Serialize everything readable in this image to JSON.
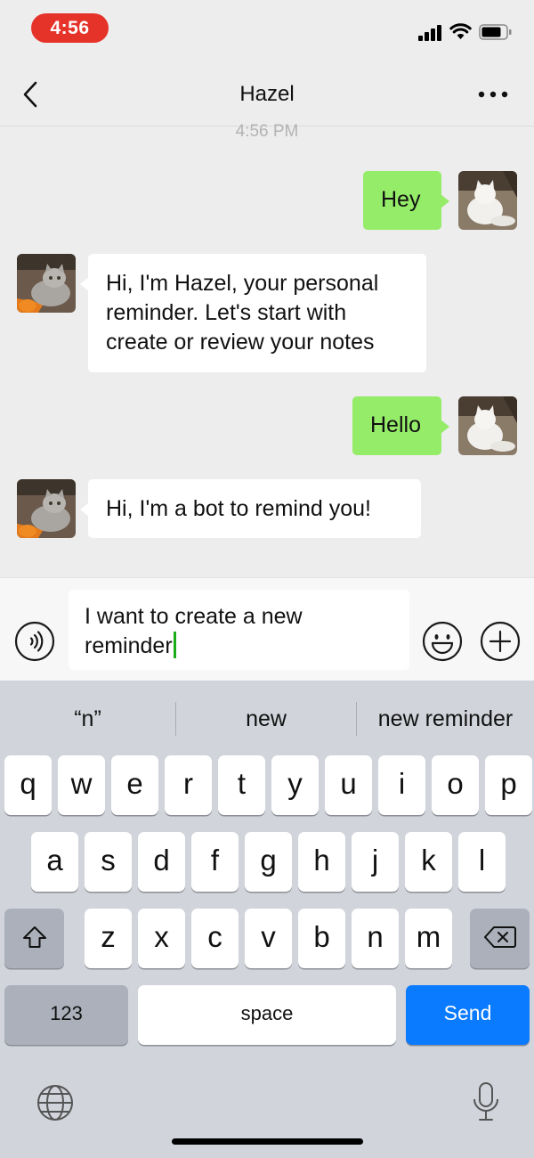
{
  "status_bar": {
    "time": "4:56"
  },
  "nav": {
    "title": "Hazel"
  },
  "chat": {
    "timestamp": "4:56 PM",
    "messages": [
      {
        "sender": "user",
        "text": "Hey"
      },
      {
        "sender": "bot",
        "text": "Hi, I'm Hazel, your personal reminder. Let's start with create or review your notes"
      },
      {
        "sender": "user",
        "text": "Hello"
      },
      {
        "sender": "bot",
        "text": "Hi, I'm a bot to remind you!"
      }
    ]
  },
  "input": {
    "value": "I want to create a new reminder"
  },
  "keyboard": {
    "suggestions": [
      "“n”",
      "new",
      "new reminder"
    ],
    "row1": [
      "q",
      "w",
      "e",
      "r",
      "t",
      "y",
      "u",
      "i",
      "o",
      "p"
    ],
    "row2": [
      "a",
      "s",
      "d",
      "f",
      "g",
      "h",
      "j",
      "k",
      "l"
    ],
    "row3": [
      "z",
      "x",
      "c",
      "v",
      "b",
      "n",
      "m"
    ],
    "numbers_label": "123",
    "space_label": "space",
    "send_label": "Send"
  },
  "colors": {
    "outgoing_bubble": "#95ec69",
    "incoming_bubble": "#ffffff",
    "send_key": "#0a7aff",
    "time_pill": "#e5332a",
    "chat_background": "#ededed"
  },
  "icons": [
    "back-icon",
    "more-icon",
    "voice-icon",
    "emoji-icon",
    "plus-icon",
    "shift-icon",
    "backspace-icon",
    "globe-icon",
    "mic-icon",
    "signal-icon",
    "wifi-icon",
    "battery-icon"
  ]
}
